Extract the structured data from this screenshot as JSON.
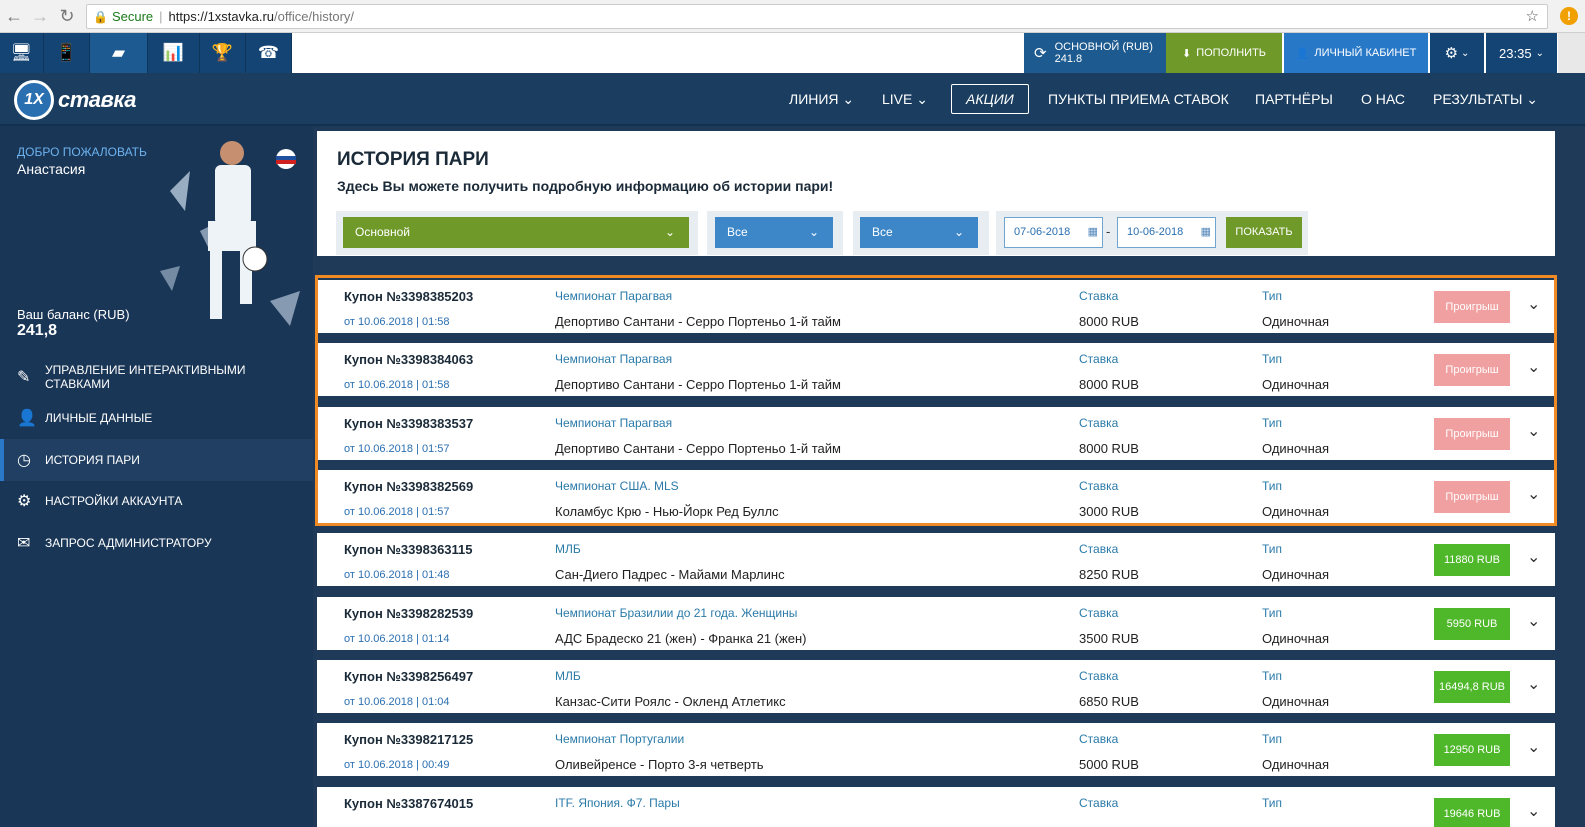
{
  "browser": {
    "secure_label": "Secure",
    "url_host": "https://1xstavka.ru",
    "url_path": "/office/history/"
  },
  "toolbar": {
    "balance_label": "ОСНОВНОЙ (RUB)",
    "balance_value": "241.8",
    "deposit_label": "ПОПОЛНИТЬ",
    "cabinet_label": "ЛИЧНЫЙ КАБИНЕТ",
    "time": "23:35"
  },
  "nav": {
    "logo_mark": "1X",
    "logo_text": "ставка",
    "items": [
      "ЛИНИЯ",
      "LIVE",
      "АКЦИИ",
      "ПУНКТЫ ПРИЕМА СТАВОК",
      "ПАРТНЁРЫ",
      "О НАС",
      "РЕЗУЛЬТАТЫ"
    ]
  },
  "sidebar": {
    "welcome": "ДОБРО ПОЖАЛОВАТЬ",
    "username": "Анастасия",
    "balance_label": "Ваш баланс (RUB)",
    "balance_value": "241,8",
    "items": [
      {
        "label1": "УПРАВЛЕНИЕ ИНТЕРАКТИВНЫМИ",
        "label2": "СТАВКАМИ",
        "icon": "ticket-icon"
      },
      {
        "label1": "ЛИЧНЫЕ ДАННЫЕ",
        "icon": "user-icon"
      },
      {
        "label1": "ИСТОРИЯ ПАРИ",
        "icon": "clock-icon"
      },
      {
        "label1": "НАСТРОЙКИ АККАУНТА",
        "icon": "gears-icon"
      },
      {
        "label1": "ЗАПРОС АДМИНИСТРАТОРУ",
        "icon": "envelope-icon"
      }
    ]
  },
  "page": {
    "title": "ИСТОРИЯ ПАРИ",
    "subtitle": "Здесь Вы можете получить подробную информацию об истории пари!"
  },
  "filters": {
    "account": "Основной",
    "filter1": "Все",
    "filter2": "Все",
    "date_from": "07-06-2018",
    "date_sep": "-",
    "date_to": "10-06-2018",
    "show_label": "ПОКАЗАТЬ"
  },
  "labels": {
    "stake": "Ставка",
    "type": "Тип"
  },
  "coupons": [
    {
      "num": "Купон №3398385203",
      "date": "от 10.06.2018 | 01:58",
      "league": "Чемпионат Парагвая",
      "match": "Депортиво Сантани - Серро Портеньо 1-й тайм",
      "stake": "8000 RUB",
      "type": "Одиночная",
      "result": "Проигрыш",
      "status": "lose"
    },
    {
      "num": "Купон №3398384063",
      "date": "от 10.06.2018 | 01:58",
      "league": "Чемпионат Парагвая",
      "match": "Депортиво Сантани - Серро Портеньо 1-й тайм",
      "stake": "8000 RUB",
      "type": "Одиночная",
      "result": "Проигрыш",
      "status": "lose"
    },
    {
      "num": "Купон №3398383537",
      "date": "от 10.06.2018 | 01:57",
      "league": "Чемпионат Парагвая",
      "match": "Депортиво Сантани - Серро Портеньо 1-й тайм",
      "stake": "8000 RUB",
      "type": "Одиночная",
      "result": "Проигрыш",
      "status": "lose"
    },
    {
      "num": "Купон №3398382569",
      "date": "от 10.06.2018 | 01:57",
      "league": "Чемпионат США. MLS",
      "match": "Коламбус Крю - Нью-Йорк Ред Буллс",
      "stake": "3000 RUB",
      "type": "Одиночная",
      "result": "Проигрыш",
      "status": "lose"
    },
    {
      "num": "Купон №3398363115",
      "date": "от 10.06.2018 | 01:48",
      "league": "МЛБ",
      "match": "Сан-Диего Падрес - Майами Марлинс",
      "stake": "8250 RUB",
      "type": "Одиночная",
      "result": "11880 RUB",
      "status": "win"
    },
    {
      "num": "Купон №3398282539",
      "date": "от 10.06.2018 | 01:14",
      "league": "Чемпионат Бразилии до 21 года. Женщины",
      "match": "АДС Брадеско 21 (жен) - Франка 21 (жен)",
      "stake": "3500 RUB",
      "type": "Одиночная",
      "result": "5950 RUB",
      "status": "win"
    },
    {
      "num": "Купон №3398256497",
      "date": "от 10.06.2018 | 01:04",
      "league": "МЛБ",
      "match": "Канзас-Сити Роялс - Окленд Атлетикс",
      "stake": "6850 RUB",
      "type": "Одиночная",
      "result": "16494,8 RUB",
      "status": "win"
    },
    {
      "num": "Купон №3398217125",
      "date": "от 10.06.2018 | 00:49",
      "league": "Чемпионат Португалии",
      "match": "Оливейренсе - Порто 3-я четверть",
      "stake": "5000 RUB",
      "type": "Одиночная",
      "result": "12950 RUB",
      "status": "win"
    },
    {
      "num": "Купон №3387674015",
      "date": "",
      "league": "ITF. Япония. Ф7. Пары",
      "match": "",
      "stake": "",
      "type": "",
      "result": "19646 RUB",
      "status": "win"
    }
  ]
}
